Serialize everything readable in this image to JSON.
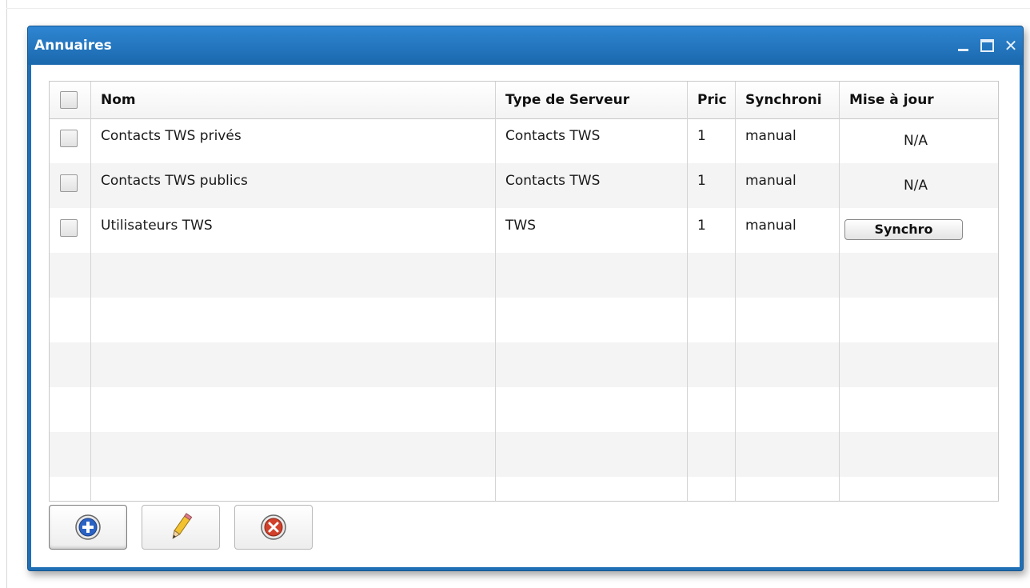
{
  "window": {
    "title": "Annuaires",
    "controls": {
      "minimize": "minimize-icon",
      "maximize": "maximize-icon",
      "close": "close-icon"
    }
  },
  "grid": {
    "columns": [
      "Nom",
      "Type de Serveur",
      "Pric",
      "Synchroni",
      "Mise à jour"
    ],
    "rows": [
      {
        "name": "Contacts TWS privés",
        "server_type": "Contacts TWS",
        "priority": "1",
        "sync": "manual",
        "update": "N/A"
      },
      {
        "name": "Contacts TWS publics",
        "server_type": "Contacts TWS",
        "priority": "1",
        "sync": "manual",
        "update": "N/A"
      },
      {
        "name": "Utilisateurs TWS",
        "server_type": "TWS",
        "priority": "1",
        "sync": "manual",
        "update_button": "Synchro"
      }
    ]
  },
  "toolbar": {
    "add_icon": "add-icon",
    "edit_icon": "pencil-icon",
    "delete_icon": "delete-icon"
  },
  "colors": {
    "window_blue": "#1f6fb5",
    "add_icon_blue": "#2a62c4",
    "delete_icon_red": "#d0402a",
    "pencil_yellow": "#f2c230"
  }
}
